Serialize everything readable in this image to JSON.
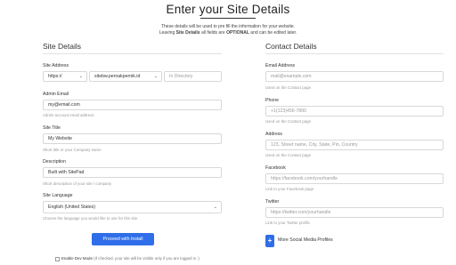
{
  "header": {
    "title": "Enter your Site Details",
    "intro_line1": "These details will be used to pre fill the information for your website.",
    "intro_line2_prefix": "Leaving ",
    "intro_line2_bold1": "Site Details",
    "intro_line2_middle": " all fields are ",
    "intro_line2_bold2": "OPTIONAL",
    "intro_line2_suffix": " and can be edited later."
  },
  "site_details": {
    "heading": "Site Details",
    "site_address": {
      "label": "Site Address",
      "protocol": "https://",
      "domain": "sitebw.pernakpernik.id",
      "directory_placeholder": "In Directory"
    },
    "admin_email": {
      "label": "Admin Email",
      "value": "my@email.com",
      "help": "Admin account email address"
    },
    "site_title": {
      "label": "Site Title",
      "value": "My Website",
      "help": "Short title or your Company name"
    },
    "description": {
      "label": "Description",
      "value": "Built with SitePad",
      "help": "Short description of your site / company"
    },
    "site_language": {
      "label": "Site Language",
      "value": "English (United States)",
      "help": "Choose the language you would like to use for this site."
    },
    "install_button": "Proceed with Install",
    "dev_mode": {
      "label": "Enable Dev Mode",
      "help": "(If checked, your site will be visible only if you are logged in :)"
    }
  },
  "contact_details": {
    "heading": "Contact Details",
    "email": {
      "label": "Email Address",
      "placeholder": "mail@example.com",
      "help": "Used on the Contact page"
    },
    "phone": {
      "label": "Phone",
      "placeholder": "+1(123)456-7890",
      "help": "Used on the Contact page"
    },
    "address": {
      "label": "Address",
      "placeholder": "123, Street name, City, State, Pin, Country",
      "help": "Used on the Contact page"
    },
    "facebook": {
      "label": "Facebook",
      "placeholder": "https://facebook.com/yourhandle",
      "help": "Link to your Facebook page"
    },
    "twitter": {
      "label": "Twitter",
      "placeholder": "https://twitter.com/yourhandle",
      "help": "Link to your Twitter profile"
    },
    "more_profiles": {
      "icon": "plus-icon",
      "label": "More Social Media Profiles"
    }
  },
  "colors": {
    "primary": "#2f6ee8"
  }
}
